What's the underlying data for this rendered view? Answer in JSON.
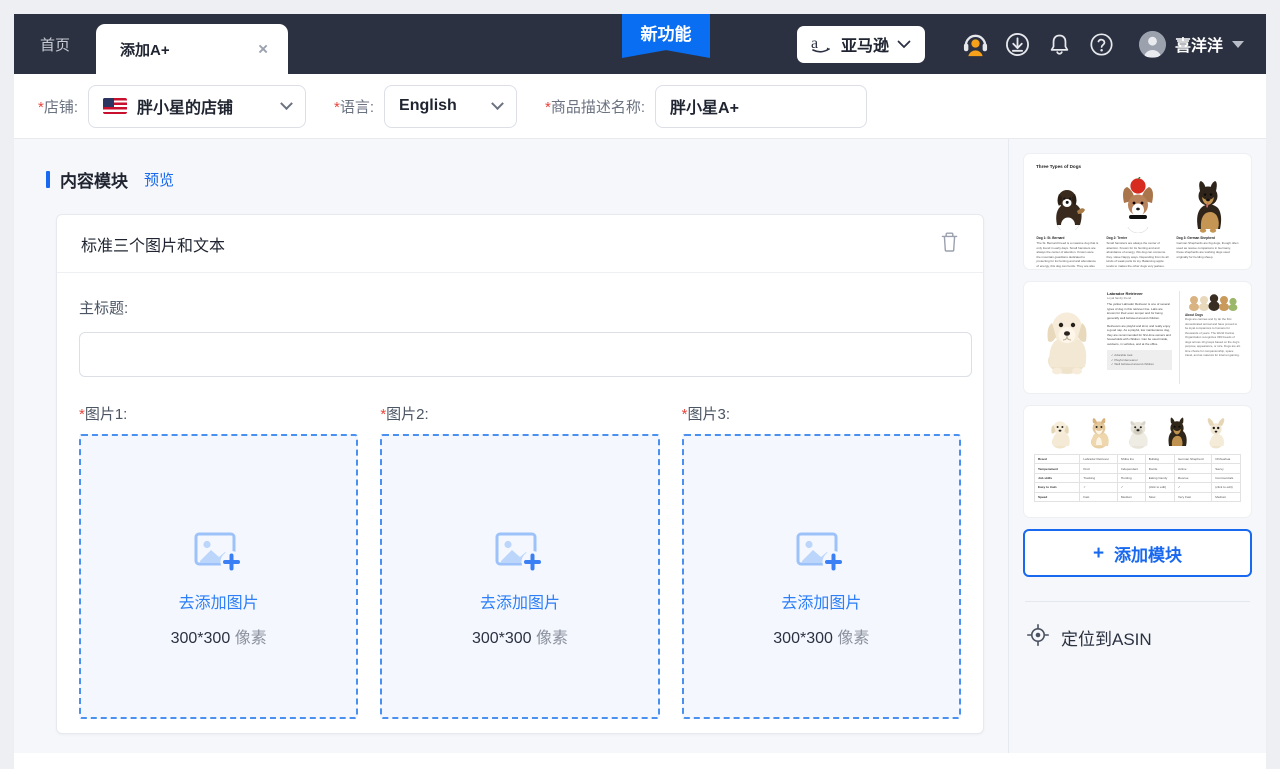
{
  "header": {
    "tabs": [
      {
        "label": "首页",
        "active": false,
        "closable": false
      },
      {
        "label": "添加A+",
        "active": true,
        "closable": true,
        "close_glyph": "×"
      }
    ],
    "new_badge": "新功能",
    "platform": {
      "label": "亚马逊",
      "logo_glyph": "a",
      "icon": "amazon-logo-icon"
    },
    "icons": [
      {
        "name": "customer-service-icon",
        "color": "#f7a11a"
      },
      {
        "name": "download-icon",
        "color": "#e6e8ec"
      },
      {
        "name": "notification-bell-icon",
        "color": "#e6e8ec"
      },
      {
        "name": "help-circle-icon",
        "color": "#e6e8ec"
      }
    ],
    "user": {
      "name": "喜洋洋",
      "avatar": "user-avatar-icon"
    }
  },
  "filterbar": {
    "shop": {
      "required": "*",
      "label": "店铺:",
      "value": "胖小星的店铺",
      "flag": "us-flag-icon"
    },
    "language": {
      "required": "*",
      "label": "语言:",
      "value": "English"
    },
    "description_name": {
      "required": "*",
      "label": "商品描述名称:",
      "value": "胖小星A+",
      "placeholder": ""
    }
  },
  "main": {
    "section_title": "内容模块",
    "preview_link": "预览",
    "module": {
      "title": "标准三个图片和文本",
      "delete_icon": "trash-icon",
      "main_title_label": "主标题:",
      "main_title_value": "",
      "main_title_placeholder": "",
      "images": [
        {
          "required": "*",
          "label": "图片1:",
          "cta": "去添加图片",
          "size": "300*300",
          "unit": "像素",
          "icon": "add-image-icon"
        },
        {
          "required": "*",
          "label": "图片2:",
          "cta": "去添加图片",
          "size": "300*300",
          "unit": "像素",
          "icon": "add-image-icon"
        },
        {
          "required": "*",
          "label": "图片3:",
          "cta": "去添加图片",
          "size": "300*300",
          "unit": "像素",
          "icon": "add-image-icon"
        }
      ]
    }
  },
  "sidebar": {
    "templates": [
      {
        "name": "three-types-of-dogs-template",
        "title": "Three Types of Dogs",
        "cells": [
          {
            "caption": "Dog 1: St. Bernard",
            "body": "The St. Bernard breed is a massive dog that is only found in early days. Small hamsters are always the center of attention. Known were the mountain guardians dedicated to protecting for its hunting and and abundance of energy, this dog can herds. They are also well known for search and rescue consume they. Have Nappy ways."
          },
          {
            "caption": "Dog 2: Terrier",
            "body": "Small hamsters are always the center of attention. Known for its hunting and and abundance of energy, this dog can consume they. Have Nappy ways. Depending from its all kinds of weak parts its toy. Balancing apple tends to makes the other dogs very jealous."
          },
          {
            "caption": "Dog 3: German Shepherd",
            "body": "German Shepherds are big dogs, though often used as rescue companions in Germany, these shepherds are working dogs used originally for herding sheep."
          }
        ]
      },
      {
        "name": "labrador-retriever-template",
        "heading": "Labrador Retriever",
        "subheading": "Loyal family friend",
        "paragraphs": [
          "The yellow Labrador Retriever is one of several types of dog in this retriever line. Labs are known for their even temper and for being generally well behaved around children.",
          "Retrievers are playful and kind, and really enjoy a good nap. As a playful, low maintenance dog, they are recommended for first-time owners and households with children. Can be used inside, outdoors, in vehicles, and at the office."
        ],
        "checklist": [
          "Adorable look",
          "Playful demeanor",
          "Well behaved around children"
        ],
        "right_heading": "About Dogs",
        "right_body": "Dogs are canines and by far the first domesticated animal and have proved to be loyal companions to humans for thousands of years. The World Canine Organization recognizes 339 breeds of dogs across 10 groups based on the dog's purpose, appearance, or size. Dogs are all-time choice for companionship, space travel, and as mascots for internet gaming."
      },
      {
        "name": "dog-comparison-table-template",
        "columns": [
          "Labrador Retriever",
          "Shiba Inu",
          "Bulldog",
          "German Shepherd",
          "Chihuahua"
        ],
        "rows": [
          {
            "header": "Breed",
            "cells": [
              "Labrador Retriever",
              "Shiba Inu",
              "Bulldog",
              "German Shepherd",
              "Chihuahua"
            ]
          },
          {
            "header": "Temperament",
            "cells": [
              "Kind",
              "Independent",
              "Docile",
              "Active",
              "Savvy"
            ]
          },
          {
            "header": "Job skills",
            "cells": [
              "Tracking",
              "Hunting",
              "Eating Candy",
              "Rescue",
              "Commercials"
            ]
          },
          {
            "header": "Easy to train",
            "cells": [
              "✓",
              "✓",
              "(click to edit)",
              "✓",
              "(click to edit)"
            ]
          },
          {
            "header": "Speed",
            "cells": [
              "Fast",
              "Medium",
              "Slow",
              "Very Fast",
              "Medium"
            ]
          }
        ]
      }
    ],
    "add_module": {
      "label": "添加模块",
      "plus": "+",
      "icon": "plus-icon"
    },
    "locate_asin": {
      "label": "定位到ASIN",
      "icon": "target-icon"
    }
  },
  "colors": {
    "header_bg": "#2b3141",
    "accent_blue": "#1868f0",
    "badge_blue": "#0a6ef2",
    "required_red": "#e8453c",
    "page_bg": "#f5f7fa",
    "dropzone_bg": "#f4f8fe",
    "dropzone_border": "#4a90f0",
    "icon_orange": "#f7a11a"
  }
}
